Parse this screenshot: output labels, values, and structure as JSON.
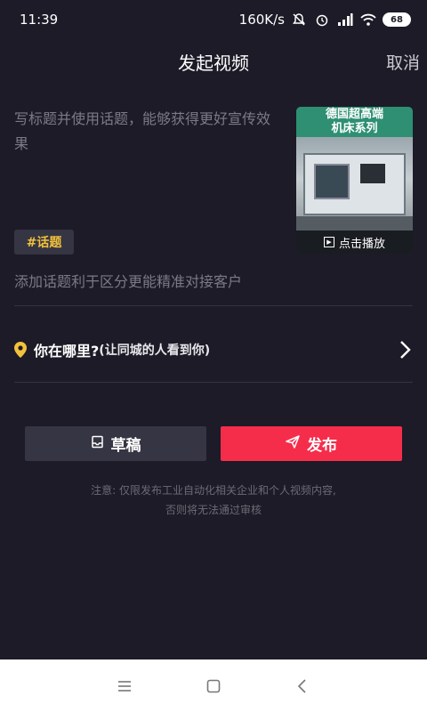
{
  "status_bar": {
    "time": "11:39",
    "speed": "160K/s",
    "battery": "68"
  },
  "header": {
    "title": "发起视频",
    "cancel_label": "取消"
  },
  "caption": {
    "placeholder": "写标题并使用话题，能够获得更好宣传效果"
  },
  "thumbnail": {
    "line1": "德国超高端",
    "line2": "机床系列",
    "play_label": "点击播放"
  },
  "topic": {
    "tag": "#话题",
    "hint": "添加话题利于区分更能精准对接客户"
  },
  "location": {
    "main": "你在哪里?",
    "sub": "(让同城的人看到你)"
  },
  "actions": {
    "draft_label": "草稿",
    "publish_label": "发布"
  },
  "notice": {
    "line1": "注意: 仅限发布工业自动化相关企业和个人视频内容,",
    "line2": "否则将无法通过审核"
  },
  "colors": {
    "accent": "#f52d4b",
    "topic": "#f3c23b",
    "pin": "#f3c23b"
  },
  "icons": [
    "mute-icon",
    "alarm-icon",
    "signal-icon",
    "wifi-icon",
    "battery-icon",
    "location-pin-icon",
    "chevron-right-icon",
    "draft-box-icon",
    "send-icon",
    "menu-icon",
    "home-icon",
    "back-icon"
  ]
}
